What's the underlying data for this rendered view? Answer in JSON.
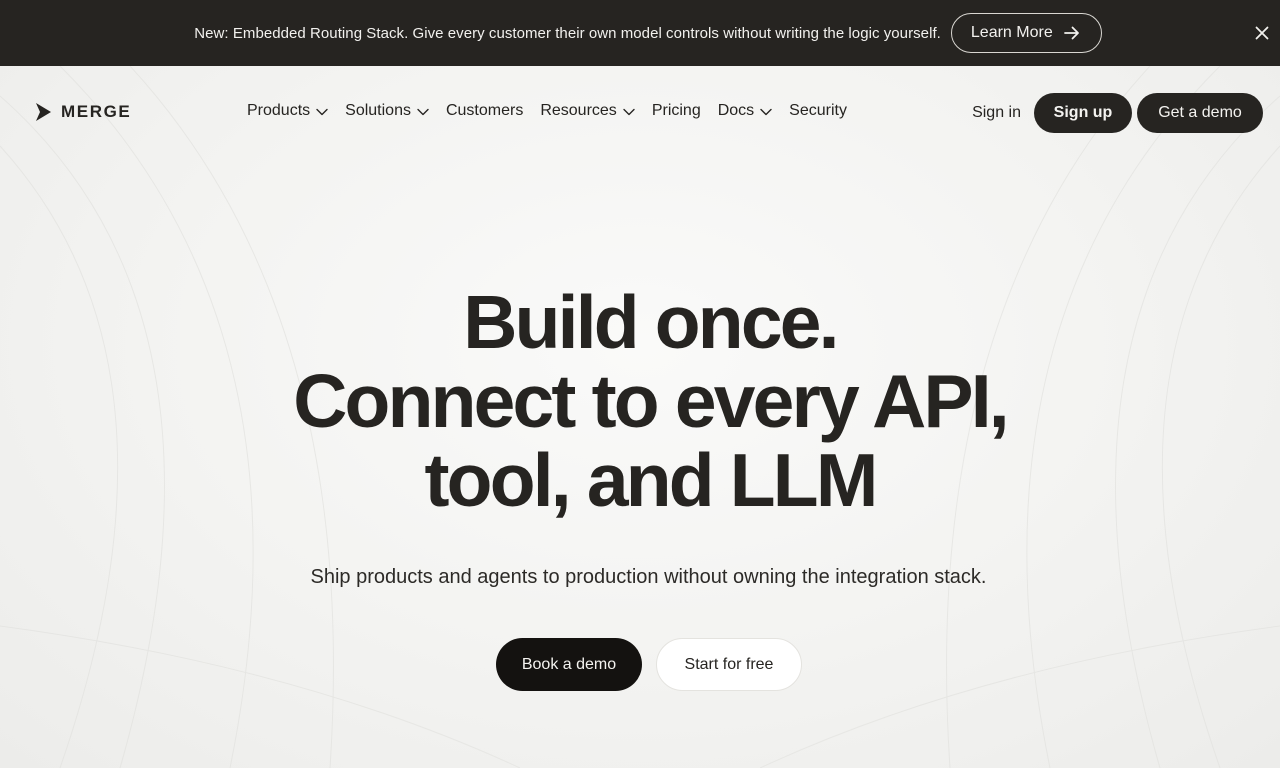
{
  "announcement": {
    "text": "New: Embedded Routing Stack. Give every customer their own model controls without writing the logic yourself.",
    "cta_label": "Learn More",
    "cta_icon": "arrow-right-icon",
    "close_icon": "close-icon"
  },
  "nav": {
    "logo_text": "MERGE",
    "links": [
      {
        "label": "Products",
        "has_dropdown": true
      },
      {
        "label": "Solutions",
        "has_dropdown": true
      },
      {
        "label": "Customers",
        "has_dropdown": false
      },
      {
        "label": "Resources",
        "has_dropdown": true
      },
      {
        "label": "Pricing",
        "has_dropdown": false
      },
      {
        "label": "Docs",
        "has_dropdown": true
      },
      {
        "label": "Security",
        "has_dropdown": false
      }
    ],
    "sign_in": "Sign in",
    "sign_up": "Sign up",
    "get_demo": "Get a demo"
  },
  "hero": {
    "title_lines": [
      "Build once.",
      "Connect to every API,",
      "tool, and LLM"
    ],
    "subtitle": "Ship products and agents to production without owning the integration stack.",
    "primary_cta": "Book a demo",
    "secondary_cta": "Start for free"
  },
  "colors": {
    "dark": "#262421",
    "button_black": "#141210",
    "background": "#f3f3f1"
  }
}
